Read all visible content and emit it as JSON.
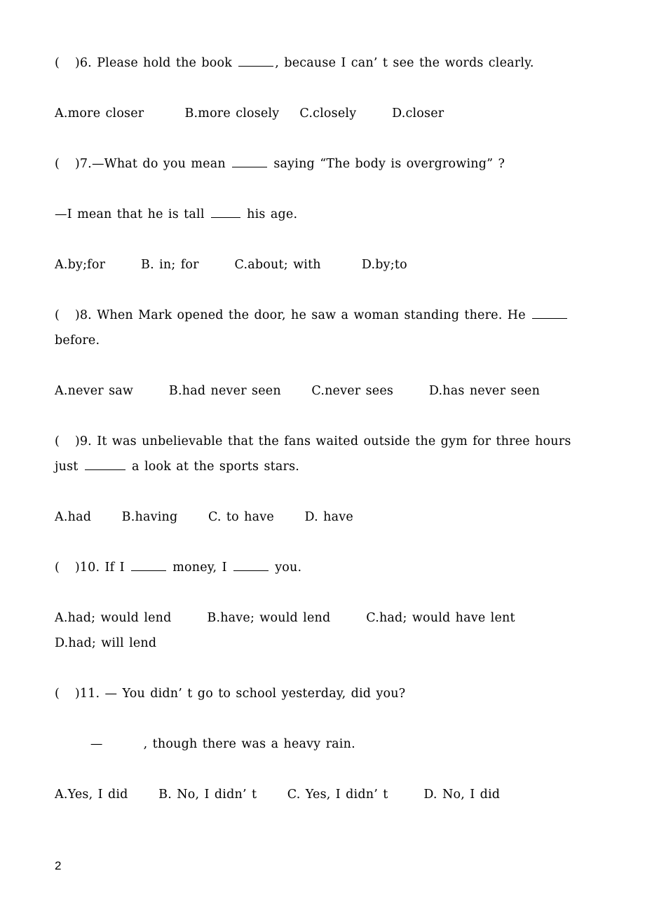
{
  "document": {
    "type": "worksheet",
    "subject": "English grammar multiple-choice exercise",
    "page_number": "2"
  },
  "questions": [
    {
      "id": "q6",
      "marker": "(   )6.",
      "stem_part_1": "(   )6. Please hold the book ",
      "stem_part_2": ", because I can’ t see the words clearly.",
      "blank_widths": [
        "w-md"
      ],
      "options_line": "A.more closer        B.more closely    C.closely       D.closer"
    },
    {
      "id": "q7",
      "marker": "(   )7.",
      "stem_part_1": "(   )7.—What do you mean ",
      "stem_part_2": " saying “The body is overgrowing” ?",
      "stem_line_2_part_1": "—I mean that he is tall ",
      "stem_line_2_part_2": " his age.",
      "options_line": "A.by;for       B. in; for       C.about; with        D.by;to"
    },
    {
      "id": "q8",
      "marker": "(   )8.",
      "stem_part_1": "(   )8. When Mark opened the door, he saw a woman standing there. He ",
      "stem_part_2": "before.",
      "options_line": "A.never saw       B.had never seen      C.never sees       D.has never seen"
    },
    {
      "id": "q9",
      "marker": "(   )9.",
      "stem_part_1": "(   )9. It was unbelievable that the fans waited outside the gym for three hours just ",
      "stem_part_2": " a look at the sports stars.",
      "options_line": "A.had      B.having      C. to have      D. have"
    },
    {
      "id": "q10",
      "marker": "(   )10.",
      "stem_part_1": "(   )10. If I ",
      "stem_part_2": " money, I ",
      "stem_part_3": " you.",
      "options_line": "A.had; would lend       B.have; would lend       C.had; would have lent        D.had; will lend"
    },
    {
      "id": "q11",
      "marker": "(   )11.",
      "stem_part_1": "(   )11. — You didn’ t go to school yesterday, did you?",
      "stem_line_2": "       —        , though there was a heavy rain.",
      "options_line": "A.Yes, I did      B. No, I didn’ t      C. Yes, I didn’ t       D. No, I did"
    }
  ]
}
